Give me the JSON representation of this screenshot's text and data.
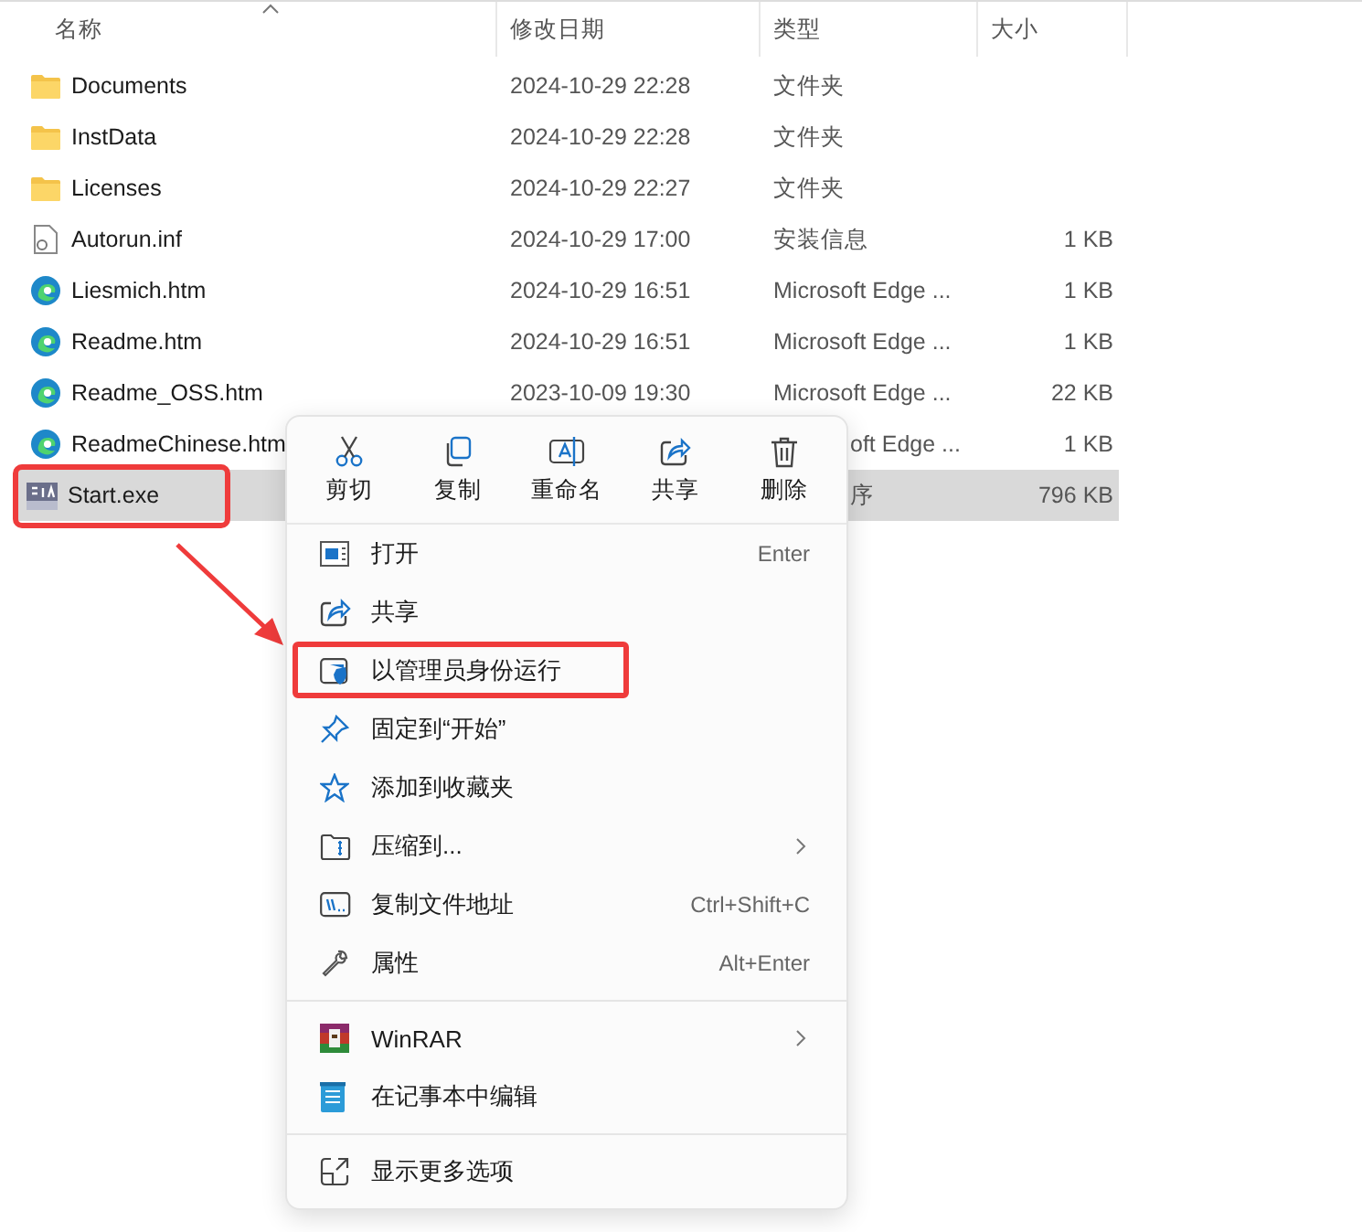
{
  "file_list": {
    "columns": [
      {
        "label": "名称",
        "sorted": true
      },
      {
        "label": "修改日期",
        "sorted": false
      },
      {
        "label": "类型",
        "sorted": false
      },
      {
        "label": "大小",
        "sorted": false
      }
    ],
    "rows": [
      {
        "kind": "folder",
        "name": "Documents",
        "date": "2024-10-29 22:28",
        "type": "文件夹",
        "selected": false,
        "highlighted": false
      },
      {
        "kind": "folder",
        "name": "InstData",
        "date": "2024-10-29 22:28",
        "type": "文件夹",
        "selected": false,
        "highlighted": false
      },
      {
        "kind": "folder",
        "name": "Licenses",
        "date": "2024-10-29 22:27",
        "type": "文件夹",
        "selected": false,
        "highlighted": false
      },
      {
        "kind": "inf",
        "name": "Autorun.inf",
        "date": "2024-10-29 17:00",
        "type": "安装信息",
        "size": "1 KB",
        "selected": false,
        "highlighted": false
      },
      {
        "kind": "edge",
        "name": "Liesmich.htm",
        "date": "2024-10-29 16:51",
        "type": "Microsoft Edge ...",
        "size": "1 KB",
        "selected": false,
        "highlighted": false
      },
      {
        "kind": "edge",
        "name": "Readme.htm",
        "date": "2024-10-29 16:51",
        "type": "Microsoft Edge ...",
        "size": "1 KB",
        "selected": false,
        "highlighted": false
      },
      {
        "kind": "edge",
        "name": "Readme_OSS.htm",
        "date": "2023-10-09 19:30",
        "type": "Microsoft Edge ...",
        "size": "22 KB",
        "selected": false,
        "highlighted": false
      },
      {
        "kind": "edge",
        "name": "ReadmeChinese.htm",
        "type": "oft Edge ...",
        "size": "1 KB",
        "selected": false,
        "highlighted": false
      },
      {
        "kind": "exe",
        "name": "Start.exe",
        "type": "序",
        "size": "796 KB",
        "selected": true,
        "highlighted": true
      }
    ]
  },
  "context_menu": {
    "toolbar": [
      {
        "label": "剪切"
      },
      {
        "label": "复制"
      },
      {
        "label": "重命名"
      },
      {
        "label": "共享"
      },
      {
        "label": "删除"
      }
    ],
    "items": [
      {
        "kind": "item",
        "label": "打开",
        "shortcut": "Enter",
        "submenu": false,
        "highlighted": false
      },
      {
        "kind": "item",
        "label": "共享",
        "submenu": false,
        "highlighted": false
      },
      {
        "kind": "item",
        "label": "以管理员身份运行",
        "submenu": false,
        "highlighted": true
      },
      {
        "kind": "item",
        "label": "固定到“开始”",
        "submenu": false,
        "highlighted": false
      },
      {
        "kind": "item",
        "label": "添加到收藏夹",
        "submenu": false,
        "highlighted": false
      },
      {
        "kind": "item",
        "label": "压缩到...",
        "submenu": true,
        "highlighted": false
      },
      {
        "kind": "item",
        "label": "复制文件地址",
        "shortcut": "Ctrl+Shift+C",
        "submenu": false,
        "highlighted": false
      },
      {
        "kind": "item",
        "label": "属性",
        "shortcut": "Alt+Enter",
        "submenu": false,
        "highlighted": false
      },
      {
        "kind": "separator"
      },
      {
        "kind": "item",
        "label": "WinRAR",
        "submenu": true,
        "highlighted": false
      },
      {
        "kind": "item",
        "label": "在记事本中编辑",
        "submenu": false,
        "highlighted": false
      },
      {
        "kind": "separator"
      },
      {
        "kind": "item",
        "label": "显示更多选项",
        "submenu": false,
        "highlighted": false
      }
    ]
  }
}
